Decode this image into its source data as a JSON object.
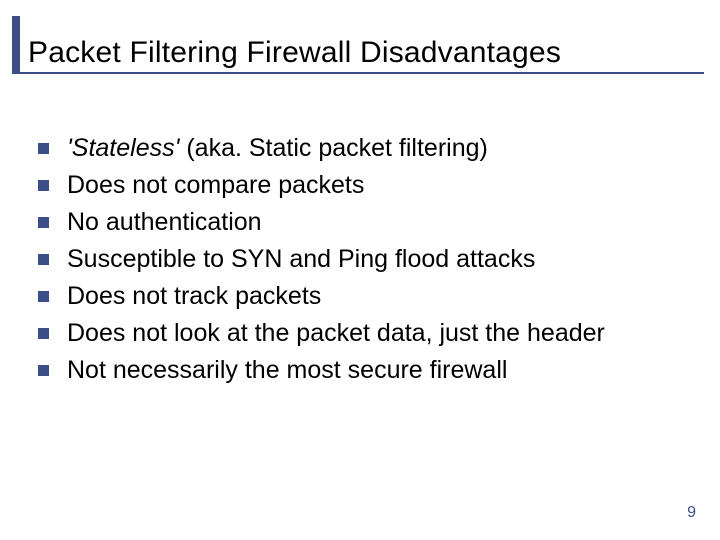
{
  "title": "Packet Filtering Firewall Disadvantages",
  "bullets": [
    {
      "pre_italic": "'Stateless'",
      "rest": " (aka. Static packet filtering)"
    },
    {
      "text": "Does not compare packets"
    },
    {
      "text": "No authentication"
    },
    {
      "text": "Susceptible to SYN and Ping flood attacks"
    },
    {
      "text": "Does not track packets"
    },
    {
      "text": "Does not look at the packet data, just the header"
    },
    {
      "text": "Not necessarily the most secure firewall"
    }
  ],
  "page_number": "9"
}
